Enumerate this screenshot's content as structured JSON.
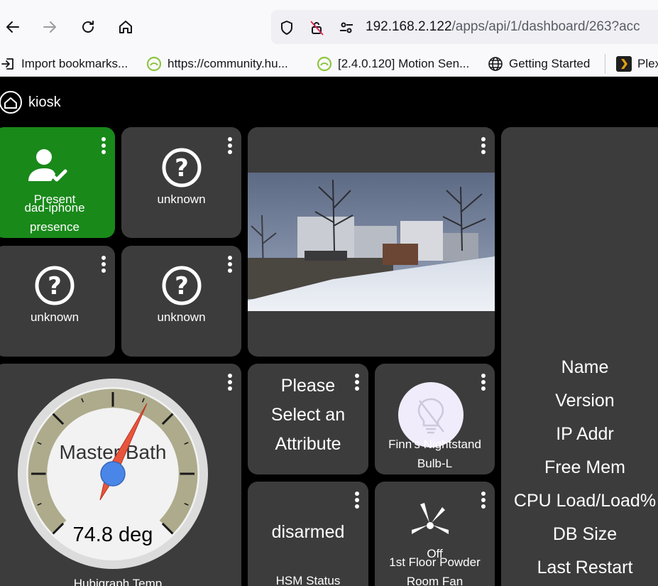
{
  "browser": {
    "url_host": "192.168.2.122",
    "url_path": "/apps/api/1/dashboard/263?acc",
    "bookmarks": [
      {
        "label": "Import bookmarks...",
        "icon": "import-icon"
      },
      {
        "label": "https://community.hu...",
        "icon": "hubitat-icon"
      },
      {
        "label": "[2.4.0.120] Motion Sen...",
        "icon": "hubitat-icon"
      },
      {
        "label": "Getting Started",
        "icon": "globe-icon"
      },
      {
        "label": "Plex",
        "icon": "plex-icon"
      }
    ]
  },
  "dashboard": {
    "title": "kiosk",
    "tiles": {
      "presence": {
        "state": "Present",
        "name": "dad-iphone",
        "attr": "presence",
        "color": "#19891a"
      },
      "unknown_1": {
        "state": "unknown"
      },
      "unknown_2": {
        "state": "unknown"
      },
      "unknown_3": {
        "state": "unknown"
      },
      "gauge": {
        "title": "Master Bath",
        "value": "74.8 deg",
        "label": "Hubigraph Temp"
      },
      "attribute": {
        "line1": "Please",
        "line2": "Select an",
        "line3": "Attribute"
      },
      "bulb": {
        "name_line1": "Finn's Nightstand",
        "name_line2": "Bulb-L"
      },
      "hsm": {
        "state": "disarmed",
        "label": "HSM Status"
      },
      "fan": {
        "state": "Off",
        "name_line1": "1st Floor Powder",
        "name_line2": "Room Fan"
      },
      "hub_info": {
        "rows": [
          "Name",
          "Version",
          "IP Addr",
          "Free Mem",
          "CPU Load/Load%",
          "DB Size",
          "Last Restart"
        ]
      }
    }
  }
}
